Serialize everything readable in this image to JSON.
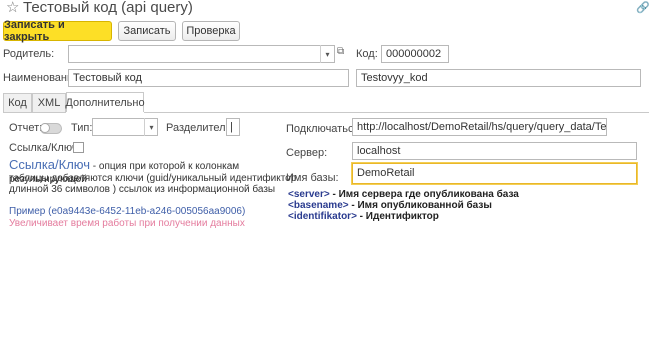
{
  "window": {
    "title": "Тестовый код (api query)",
    "star_icon": "star-icon",
    "link_icon": "link-icon"
  },
  "toolbar": {
    "save_close_label": "Записать и закрыть",
    "save_label": "Записать",
    "check_label": "Проверка"
  },
  "header": {
    "parent_label": "Родитель:",
    "parent_value": "",
    "code_label": "Код:",
    "code_value": "000000002",
    "name_label": "Наименование:",
    "name_value": "Тестовый код",
    "name_translit": "Testovyy_kod"
  },
  "tabs": [
    {
      "label": "Код"
    },
    {
      "label": "XML"
    },
    {
      "label": "Дополнительно"
    }
  ],
  "left": {
    "report_label": "Отчет:",
    "type_label": "Тип:",
    "type_value": "",
    "separator_label": "Разделитель:",
    "separator_value": "|",
    "link_key_label": "Ссылка/Ключ:",
    "help_title": "Ссылка/Ключ",
    "help_line1": " - опция при которой к колонкам результирующей",
    "help_line2": "таблицы добавляются ключи (guid/уникальный идентификтор",
    "help_line3": "длинной 36 символов )  ссылок из информационной базы",
    "example": "Пример (e0a9443e-6452-11eb-a246-005056aa9006)",
    "warning": "Увеличивает время работы при получении данных"
  },
  "right": {
    "connect_label": "Подключаться:",
    "connect_value": "http://localhost/DemoRetail/hs/query/query_data/Testovyy_kod",
    "server_label": "Сервер:",
    "server_value": "localhost",
    "db_label": "Имя базы:",
    "db_value": "DemoRetail",
    "params": [
      {
        "key": "<server>",
        "desc": " - Имя сервера где опубликована база"
      },
      {
        "key": "<basename>",
        "desc": " - Имя опубликованной базы"
      },
      {
        "key": "<identifikator>",
        "desc": " - Идентификтор"
      }
    ]
  },
  "colors": {
    "primary_button": "#fddf26",
    "help_link": "#4a6fb5",
    "warning": "#e47b9d",
    "focus_border": "#e9b72a"
  }
}
